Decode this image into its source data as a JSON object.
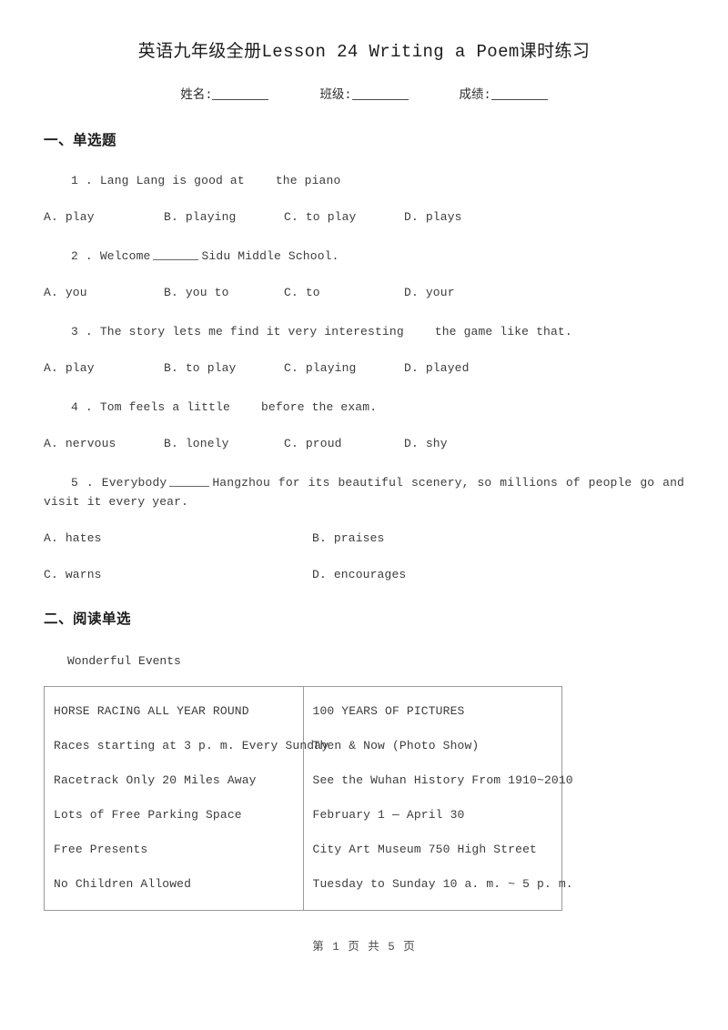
{
  "document": {
    "title": "英语九年级全册Lesson 24 Writing a Poem课时练习"
  },
  "info": {
    "name_label": "姓名:",
    "class_label": "班级:",
    "score_label": "成绩:"
  },
  "sections": [
    {
      "heading": "一、单选题"
    },
    {
      "heading": "二、阅读单选"
    }
  ],
  "questions": [
    {
      "number": "1",
      "sep": ".",
      "text_before": "Lang Lang is good at",
      "blank": "gap",
      "text_after": "the piano",
      "options": [
        "A. play",
        "B. playing",
        "C. to play",
        "D. plays"
      ]
    },
    {
      "number": "2",
      "sep": ".",
      "text_before": "Welcome",
      "blank": "line",
      "text_after": "Sidu Middle School.",
      "options": [
        "A. you",
        "B. you to",
        "C. to",
        "D. your"
      ]
    },
    {
      "number": "3",
      "sep": ".",
      "text_before": "The story lets me find it very interesting",
      "blank": "gap",
      "text_after": "the game like that.",
      "options": [
        "A. play",
        "B. to play",
        "C. playing",
        "D. played"
      ]
    },
    {
      "number": "4",
      "sep": ".",
      "text_before": "Tom feels a little",
      "blank": "gap",
      "text_after": "before the exam.",
      "options": [
        "A. nervous",
        "B. lonely",
        "C. proud",
        "D. shy"
      ]
    },
    {
      "number": "5",
      "sep": ".",
      "text_before": "Everybody",
      "blank": "line",
      "text_after": "Hangzhou for its beautiful scenery, so millions of people go and visit it every year.",
      "options": [
        "A. hates",
        "B. praises",
        "C. warns",
        "D. encourages"
      ]
    }
  ],
  "reading": {
    "passage_title": "Wonderful Events",
    "table": {
      "left_column": [
        "HORSE RACING ALL YEAR ROUND",
        "Races starting at 3 p. m. Every Sunday",
        "Racetrack Only 20 Miles Away",
        "Lots of Free Parking Space",
        "Free Presents",
        "No Children Allowed"
      ],
      "right_column": [
        "100 YEARS OF PICTURES",
        "Then & Now (Photo Show)",
        "See the Wuhan History From 1910~2010",
        "February 1 — April 30",
        "City Art Museum 750 High Street",
        "Tuesday to Sunday 10 a. m. ~ 5 p. m."
      ]
    }
  },
  "footer": {
    "text": "第 1 页 共 5 页"
  }
}
